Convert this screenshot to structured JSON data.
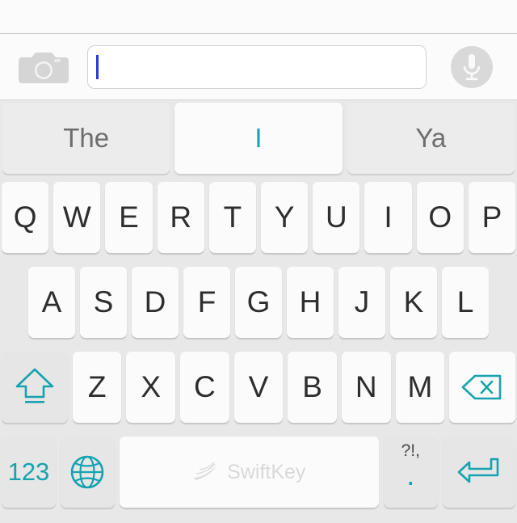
{
  "app": {
    "name": "SwiftKey Keyboard",
    "blank_area": ""
  },
  "input_bar": {
    "camera_icon": "camera-icon",
    "mic_icon": "microphone-icon",
    "field_value": "",
    "field_placeholder": "",
    "caret_color": "#2b38d4"
  },
  "prediction_bar": {
    "items": [
      {
        "label": "The",
        "selected": false
      },
      {
        "label": "I",
        "selected": true
      },
      {
        "label": "Ya",
        "selected": false
      }
    ]
  },
  "keyboard": {
    "accent_color": "#17a2b0",
    "key_text_color": "#2e2e2e",
    "background_color": "#e8e8e8",
    "rows": [
      {
        "name": "row-1",
        "keys": [
          "Q",
          "W",
          "E",
          "R",
          "T",
          "Y",
          "U",
          "I",
          "O",
          "P"
        ]
      },
      {
        "name": "row-2",
        "keys": [
          "A",
          "S",
          "D",
          "F",
          "G",
          "H",
          "J",
          "K",
          "L"
        ]
      },
      {
        "name": "row-3",
        "keys": [
          "Z",
          "X",
          "C",
          "V",
          "B",
          "N",
          "M"
        ],
        "shift_icon": "shift-icon",
        "backspace_icon": "backspace-icon"
      },
      {
        "name": "row-4",
        "numeric_label": "123",
        "globe_icon": "globe-icon",
        "space_logo_text": "SwiftKey",
        "period_top_label": "?!,",
        "period_label": ".",
        "enter_icon": "enter-icon"
      }
    ]
  }
}
